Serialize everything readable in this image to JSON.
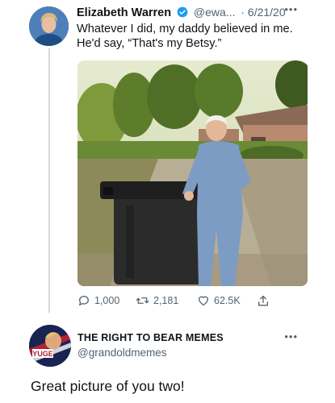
{
  "tweet": {
    "author_name": "Elizabeth Warren",
    "handle": "@ewa...",
    "date": "· 6/21/20",
    "more_icon": "more-horizontal-icon",
    "text_line1": "Whatever I did, my daddy believed in me.",
    "text_line2": "He'd say, “That's my Betsy.”",
    "actions": {
      "reply_count": "1,000",
      "retweet_count": "2,181",
      "like_count": "62.5K"
    }
  },
  "reply": {
    "author_name": "THE RIGHT TO BEAR MEMES",
    "handle": "@grandoldmemes",
    "avatar_text": "YUGE",
    "text": "Great picture of you two!"
  },
  "colors": {
    "verified": "#1d9bf0",
    "secondary_text": "#536471",
    "thread_line": "#cfd9de"
  }
}
